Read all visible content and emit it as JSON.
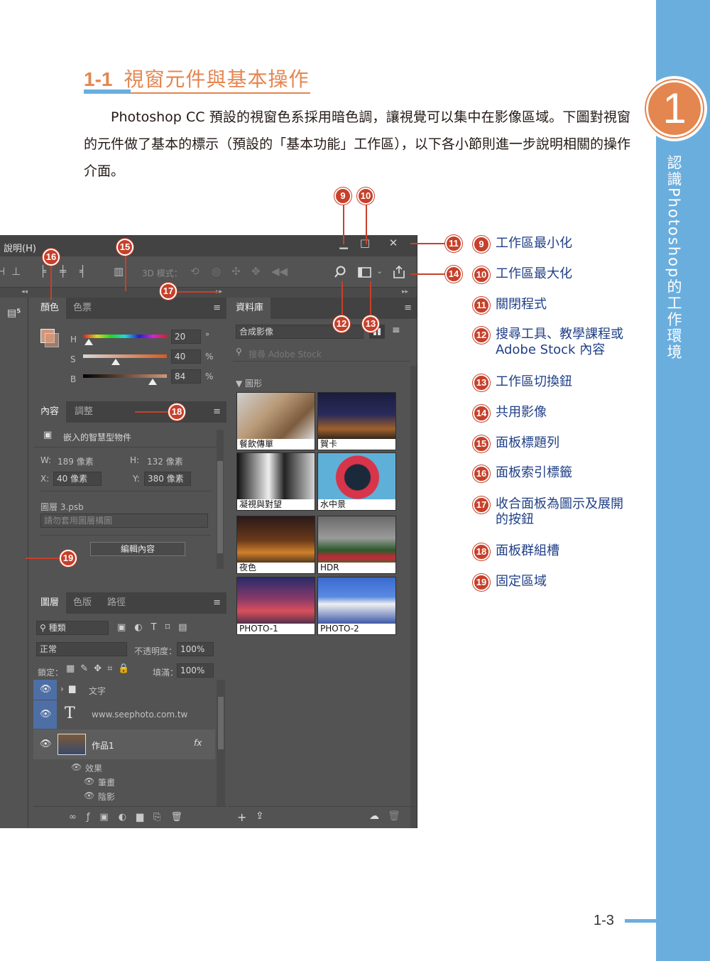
{
  "chapter": {
    "number": "1",
    "title": "認識Photoshop的工作環境"
  },
  "section": {
    "number": "1-1",
    "title": "視窗元件與基本操作"
  },
  "intro": "Photoshop CC 預設的視窗色系採用暗色調，讓視覺可以集中在影像區域。下圖對視窗的元件做了基本的標示（預設的「基本功能」工作區），以下各小節則進一步說明相關的操作介面。",
  "screenshot": {
    "menu": "說明(H)",
    "win_minimize": "▁",
    "win_maximize": "□",
    "win_close": "✕",
    "options_3d_mode": "3D 模式：",
    "color_panel": {
      "tabs": [
        "顏色",
        "色票"
      ],
      "labels": [
        "H",
        "S",
        "B"
      ],
      "values": [
        "20",
        "40",
        "84"
      ],
      "units": [
        "°",
        "%",
        "%"
      ]
    },
    "properties_panel": {
      "tabs": [
        "內容",
        "調整"
      ],
      "smart_object": "嵌入的智慧型物件",
      "w_label": "W:",
      "w_value": "189 像素",
      "h_label": "H:",
      "h_value": "132 像素",
      "x_label": "X:",
      "x_value": "40 像素",
      "y_label": "Y:",
      "y_value": "380 像素",
      "layer_label": "圖層 3.psb",
      "comp_placeholder": "請勿套用圖層構圖",
      "edit_button": "編輯內容"
    },
    "library_panel": {
      "tab": "資料庫",
      "library_name": "合成影像",
      "search_placeholder": "搜尋 Adobe Stock",
      "group": "▼ 圖形",
      "items": [
        "餐飲傳單",
        "賀卡",
        "凝視與對望",
        "水中景",
        "夜色",
        "HDR",
        "PHOTO-1",
        "PHOTO-2"
      ]
    },
    "layers_panel": {
      "tabs": [
        "圖層",
        "色版",
        "路徑"
      ],
      "filter": "種類",
      "blend_mode": "正常",
      "opacity_label": "不透明度：",
      "opacity_value": "100%",
      "lock_label": "鎖定：",
      "fill_label": "填滿：",
      "fill_value": "100%",
      "layers": [
        "文字",
        "www.seephoto.com.tw",
        "作品1"
      ],
      "effects_label": "效果",
      "effects": [
        "筆畫",
        "陰影"
      ]
    }
  },
  "callouts": [
    "9",
    "10",
    "11",
    "12",
    "13",
    "14",
    "15",
    "16",
    "17",
    "18",
    "19"
  ],
  "legend": [
    {
      "num": "9",
      "text": "工作區最小化"
    },
    {
      "num": "10",
      "text": "工作區最大化"
    },
    {
      "num": "11",
      "text": "關閉程式"
    },
    {
      "num": "12",
      "text": "搜尋工具、教學課程或 Adobe Stock 內容"
    },
    {
      "num": "13",
      "text": "工作區切換鈕"
    },
    {
      "num": "14",
      "text": "共用影像"
    },
    {
      "num": "15",
      "text": "面板標題列"
    },
    {
      "num": "16",
      "text": "面板索引標籤"
    },
    {
      "num": "17",
      "text": "收合面板為圖示及展開的按鈕"
    },
    {
      "num": "18",
      "text": "面板群組槽"
    },
    {
      "num": "19",
      "text": "固定區域"
    }
  ],
  "page_number": "1-3",
  "colors": {
    "accent_orange": "#e48650",
    "tab_blue": "#6aaede",
    "callout_red": "#c7402a",
    "legend_blue": "#1f3f86"
  }
}
